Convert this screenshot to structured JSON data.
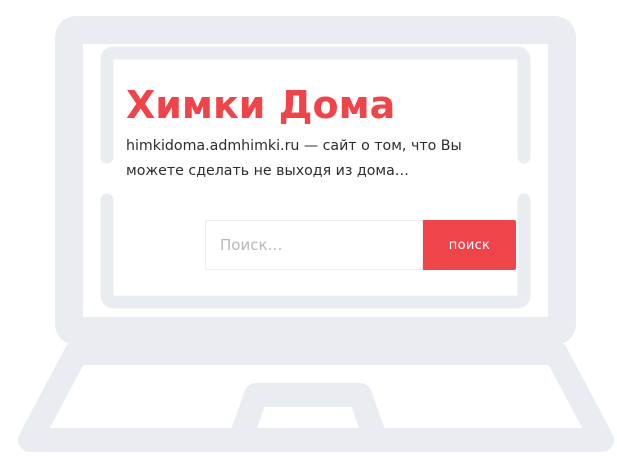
{
  "site": {
    "title": "Химки Дома",
    "description": "himkidoma.admhimki.ru — сайт о том, что Вы можете сделать не выходя из дома…"
  },
  "search": {
    "placeholder": "Поиск…",
    "value": "",
    "button_label": "поиск"
  },
  "icons": {
    "illustration": "laptop-outline-icon"
  },
  "colors": {
    "accent": "#f0444b",
    "outline": "#e9edf2",
    "text": "#2d2d2d",
    "placeholder": "#b8b8b8"
  }
}
